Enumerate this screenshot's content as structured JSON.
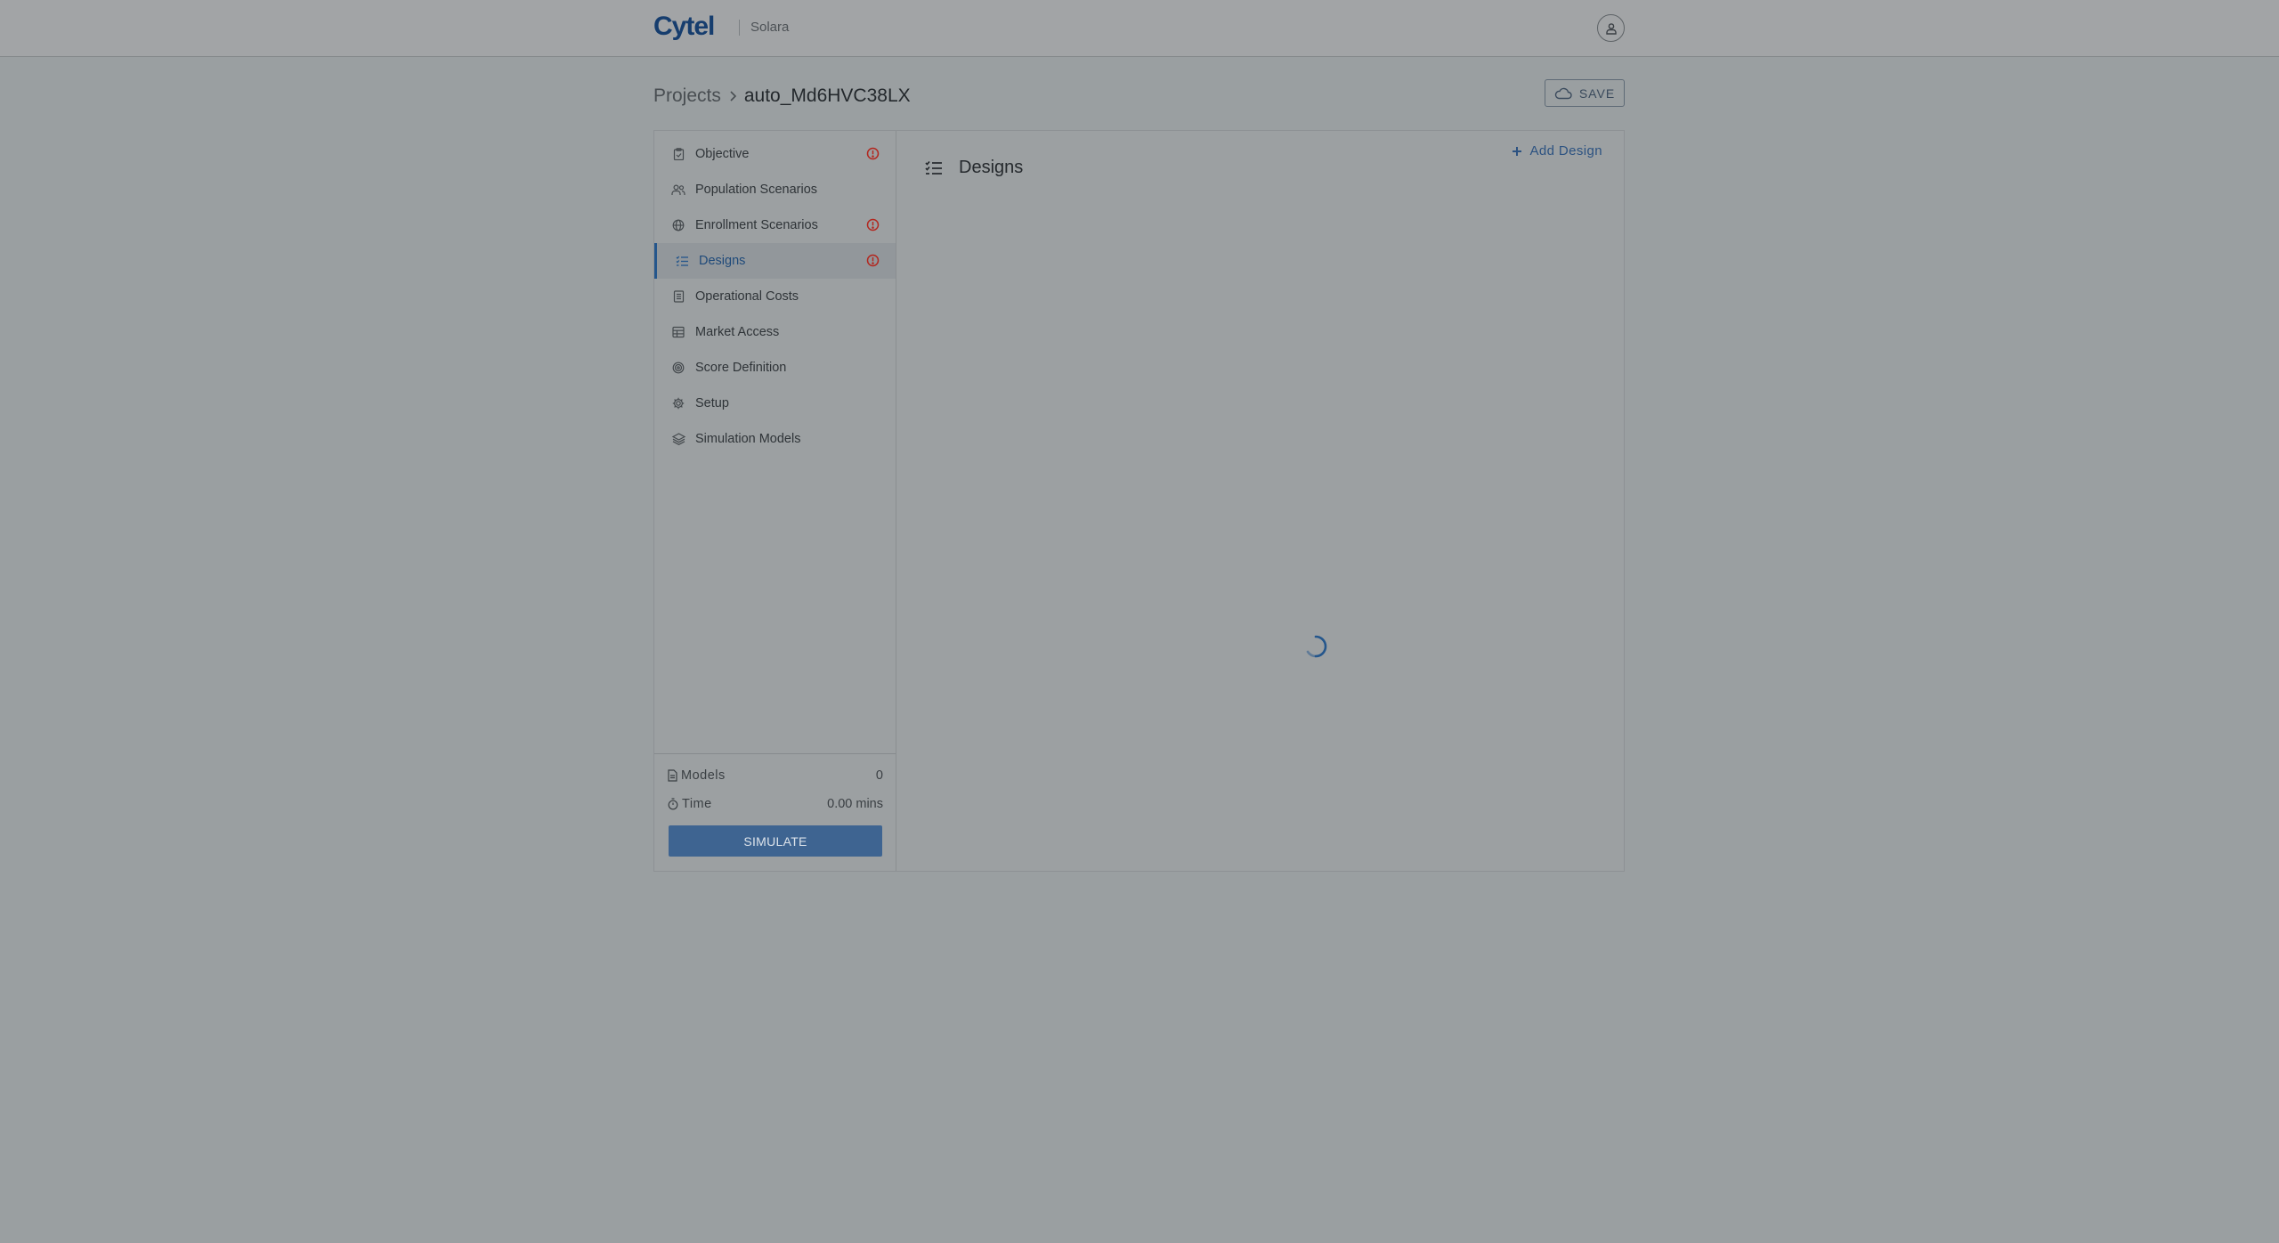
{
  "header": {
    "logo_text": "Cytel",
    "app_name": "Solara",
    "account_icon": "user-icon"
  },
  "breadcrumb": {
    "root": "Projects",
    "current": "auto_Md6HVC38LX"
  },
  "toolbar": {
    "save_label": "SAVE",
    "save_icon": "cloud-icon"
  },
  "sidebar": {
    "items": [
      {
        "label": "Objective",
        "icon": "clipboard-icon",
        "alert": true
      },
      {
        "label": "Population Scenarios",
        "icon": "users-icon",
        "alert": false
      },
      {
        "label": "Enrollment Scenarios",
        "icon": "globe-icon",
        "alert": true
      },
      {
        "label": "Designs",
        "icon": "list-check-icon",
        "alert": true,
        "active": true
      },
      {
        "label": "Operational Costs",
        "icon": "receipt-icon",
        "alert": false
      },
      {
        "label": "Market Access",
        "icon": "table-icon",
        "alert": false
      },
      {
        "label": "Score Definition",
        "icon": "target-icon",
        "alert": false
      },
      {
        "label": "Setup",
        "icon": "gear-icon",
        "alert": false
      },
      {
        "label": "Simulation Models",
        "icon": "layers-icon",
        "alert": false
      }
    ],
    "footer": {
      "models_label": "Models",
      "models_value": "0",
      "time_label": "Time",
      "time_value": "0.00 mins",
      "simulate_label": "SIMULATE"
    }
  },
  "content": {
    "title": "Designs",
    "add_label": "Add Design"
  },
  "colors": {
    "accent": "#24568c",
    "alert": "#b3261e",
    "overlay_bg": "#9a9fa1"
  }
}
